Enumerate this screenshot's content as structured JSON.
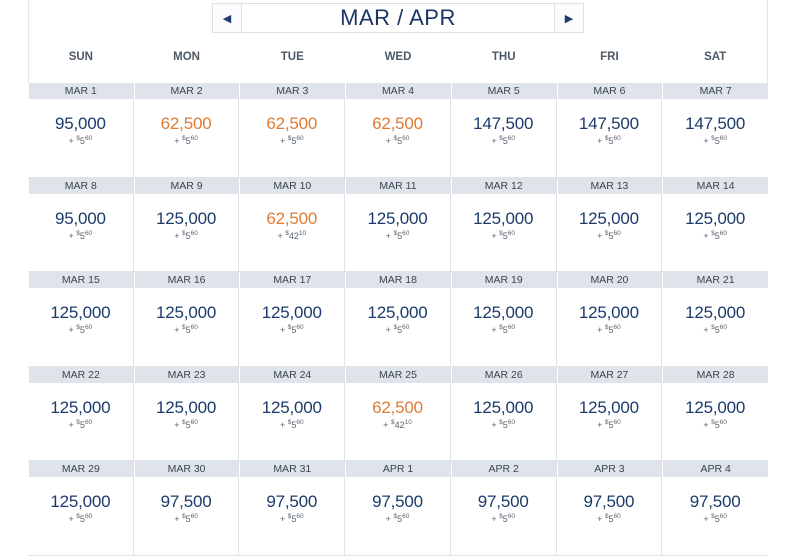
{
  "header": {
    "title": "MAR / APR",
    "prev_icon": "triangle-left-icon",
    "next_icon": "triangle-right-icon"
  },
  "colors": {
    "regular": "#1c3b6b",
    "lowest": "#e07b35"
  },
  "weekdays": [
    "SUN",
    "MON",
    "TUE",
    "WED",
    "THU",
    "FRI",
    "SAT"
  ],
  "days": [
    {
      "date": "MAR 1",
      "miles": "95,000",
      "fee": "5",
      "cents": "60",
      "low": false
    },
    {
      "date": "MAR 2",
      "miles": "62,500",
      "fee": "5",
      "cents": "60",
      "low": true
    },
    {
      "date": "MAR 3",
      "miles": "62,500",
      "fee": "5",
      "cents": "60",
      "low": true
    },
    {
      "date": "MAR 4",
      "miles": "62,500",
      "fee": "5",
      "cents": "60",
      "low": true
    },
    {
      "date": "MAR 5",
      "miles": "147,500",
      "fee": "5",
      "cents": "60",
      "low": false
    },
    {
      "date": "MAR 6",
      "miles": "147,500",
      "fee": "5",
      "cents": "60",
      "low": false
    },
    {
      "date": "MAR 7",
      "miles": "147,500",
      "fee": "5",
      "cents": "60",
      "low": false
    },
    {
      "date": "MAR 8",
      "miles": "95,000",
      "fee": "5",
      "cents": "60",
      "low": false
    },
    {
      "date": "MAR 9",
      "miles": "125,000",
      "fee": "5",
      "cents": "60",
      "low": false
    },
    {
      "date": "MAR 10",
      "miles": "62,500",
      "fee": "42",
      "cents": "10",
      "low": true
    },
    {
      "date": "MAR 11",
      "miles": "125,000",
      "fee": "5",
      "cents": "60",
      "low": false
    },
    {
      "date": "MAR 12",
      "miles": "125,000",
      "fee": "5",
      "cents": "60",
      "low": false
    },
    {
      "date": "MAR 13",
      "miles": "125,000",
      "fee": "5",
      "cents": "60",
      "low": false
    },
    {
      "date": "MAR 14",
      "miles": "125,000",
      "fee": "5",
      "cents": "60",
      "low": false
    },
    {
      "date": "MAR 15",
      "miles": "125,000",
      "fee": "5",
      "cents": "60",
      "low": false
    },
    {
      "date": "MAR 16",
      "miles": "125,000",
      "fee": "5",
      "cents": "60",
      "low": false
    },
    {
      "date": "MAR 17",
      "miles": "125,000",
      "fee": "5",
      "cents": "60",
      "low": false
    },
    {
      "date": "MAR 18",
      "miles": "125,000",
      "fee": "5",
      "cents": "60",
      "low": false
    },
    {
      "date": "MAR 19",
      "miles": "125,000",
      "fee": "5",
      "cents": "60",
      "low": false
    },
    {
      "date": "MAR 20",
      "miles": "125,000",
      "fee": "5",
      "cents": "60",
      "low": false
    },
    {
      "date": "MAR 21",
      "miles": "125,000",
      "fee": "5",
      "cents": "60",
      "low": false
    },
    {
      "date": "MAR 22",
      "miles": "125,000",
      "fee": "5",
      "cents": "60",
      "low": false
    },
    {
      "date": "MAR 23",
      "miles": "125,000",
      "fee": "5",
      "cents": "60",
      "low": false
    },
    {
      "date": "MAR 24",
      "miles": "125,000",
      "fee": "5",
      "cents": "60",
      "low": false
    },
    {
      "date": "MAR 25",
      "miles": "62,500",
      "fee": "42",
      "cents": "10",
      "low": true
    },
    {
      "date": "MAR 26",
      "miles": "125,000",
      "fee": "5",
      "cents": "60",
      "low": false
    },
    {
      "date": "MAR 27",
      "miles": "125,000",
      "fee": "5",
      "cents": "60",
      "low": false
    },
    {
      "date": "MAR 28",
      "miles": "125,000",
      "fee": "5",
      "cents": "60",
      "low": false
    },
    {
      "date": "MAR 29",
      "miles": "125,000",
      "fee": "5",
      "cents": "60",
      "low": false
    },
    {
      "date": "MAR 30",
      "miles": "97,500",
      "fee": "5",
      "cents": "60",
      "low": false
    },
    {
      "date": "MAR 31",
      "miles": "97,500",
      "fee": "5",
      "cents": "60",
      "low": false
    },
    {
      "date": "APR 1",
      "miles": "97,500",
      "fee": "5",
      "cents": "60",
      "low": false
    },
    {
      "date": "APR 2",
      "miles": "97,500",
      "fee": "5",
      "cents": "60",
      "low": false
    },
    {
      "date": "APR 3",
      "miles": "97,500",
      "fee": "5",
      "cents": "60",
      "low": false
    },
    {
      "date": "APR 4",
      "miles": "97,500",
      "fee": "5",
      "cents": "60",
      "low": false
    }
  ]
}
